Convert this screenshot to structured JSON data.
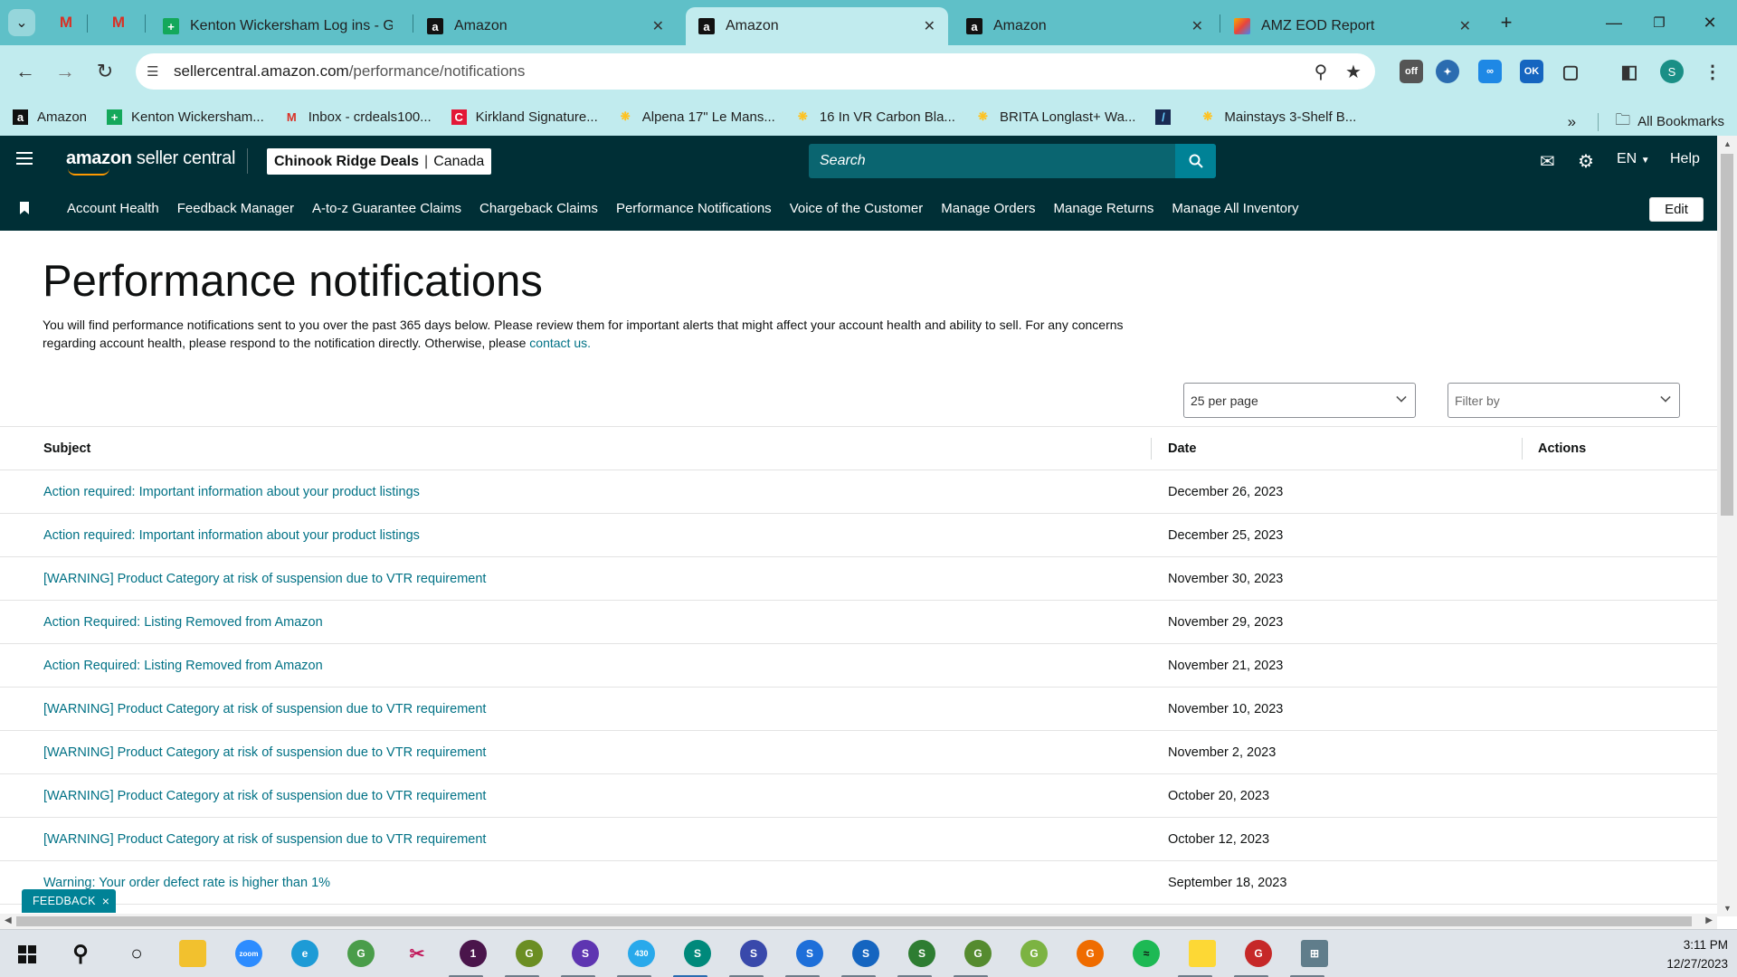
{
  "browser": {
    "tabs": [
      {
        "title": "Kenton Wickersham Log ins - G",
        "favicon": "green-plus-icon",
        "active": false
      },
      {
        "title": "Amazon",
        "favicon": "amazon-icon",
        "active": false
      },
      {
        "title": "Amazon",
        "favicon": "amazon-icon",
        "active": true
      },
      {
        "title": "Amazon",
        "favicon": "amazon-icon",
        "active": false
      },
      {
        "title": "AMZ EOD Report",
        "favicon": "sheets-icon",
        "active": false
      }
    ],
    "url_host": "sellercentral.amazon.com",
    "url_path": "/performance/notifications",
    "profile_initial": "S",
    "extension_badges": {
      "off": "off",
      "ok": "OK"
    },
    "bookmarks": [
      {
        "label": "Amazon",
        "icon": "amazon-icon"
      },
      {
        "label": "Kenton Wickersham...",
        "icon": "green-plus-icon"
      },
      {
        "label": "Inbox - crdeals100...",
        "icon": "gmail-icon"
      },
      {
        "label": "Kirkland Signature...",
        "icon": "c-logo-icon"
      },
      {
        "label": "Alpena 17\" Le Mans...",
        "icon": "walmart-spark-icon"
      },
      {
        "label": "16 In VR Carbon Bla...",
        "icon": "walmart-spark-icon"
      },
      {
        "label": "BRITA Longlast+ Wa...",
        "icon": "walmart-spark-icon"
      },
      {
        "label": "",
        "icon": "dark-app-icon"
      },
      {
        "label": "Mainstays 3-Shelf B...",
        "icon": "walmart-spark-icon"
      }
    ],
    "all_bookmarks": "All Bookmarks"
  },
  "header": {
    "logo_text_bold": "amazon",
    "logo_text": " seller central",
    "store_name": "Chinook Ridge Deals",
    "marketplace": "Canada",
    "search_placeholder": "Search",
    "language": "EN",
    "help": "Help"
  },
  "nav": {
    "items": [
      "Account Health",
      "Feedback Manager",
      "A-to-z Guarantee Claims",
      "Chargeback Claims",
      "Performance Notifications",
      "Voice of the Customer",
      "Manage Orders",
      "Manage Returns",
      "Manage All Inventory"
    ],
    "edit": "Edit"
  },
  "page": {
    "title": "Performance notifications",
    "description": "You will find performance notifications sent to you over the past 365 days below. Please review them for important alerts that might affect your account health and ability to sell. For any concerns regarding account health, please respond to the notification directly. Otherwise, please ",
    "contact_link": "contact us.",
    "per_page": "25 per page",
    "filter_placeholder": "Filter by"
  },
  "table": {
    "columns": {
      "subject": "Subject",
      "date": "Date",
      "actions": "Actions"
    },
    "rows": [
      {
        "subject": "Action required: Important information about your product listings",
        "date": "December 26, 2023"
      },
      {
        "subject": "Action required: Important information about your product listings",
        "date": "December 25, 2023"
      },
      {
        "subject": "[WARNING] Product Category at risk of suspension due to VTR requirement",
        "date": "November 30, 2023"
      },
      {
        "subject": "Action Required: Listing Removed from Amazon",
        "date": "November 29, 2023"
      },
      {
        "subject": "Action Required: Listing Removed from Amazon",
        "date": "November 21, 2023"
      },
      {
        "subject": "[WARNING] Product Category at risk of suspension due to VTR requirement",
        "date": "November 10, 2023"
      },
      {
        "subject": "[WARNING] Product Category at risk of suspension due to VTR requirement",
        "date": "November 2, 2023"
      },
      {
        "subject": "[WARNING] Product Category at risk of suspension due to VTR requirement",
        "date": "October 20, 2023"
      },
      {
        "subject": "[WARNING] Product Category at risk of suspension due to VTR requirement",
        "date": "October 12, 2023"
      },
      {
        "subject": "Warning: Your order defect rate is higher than 1%",
        "date": "September 18, 2023"
      }
    ]
  },
  "feedback": "FEEDBACK",
  "taskbar": {
    "time": "3:11 PM",
    "date": "12/27/2023",
    "badges": {
      "slack": "1",
      "telegram": "430"
    }
  },
  "colors": {
    "browser_chrome": "#5fc0c8",
    "toolbar": "#c1ebee",
    "header": "#002f36",
    "link": "#007185",
    "accent": "#008296"
  }
}
